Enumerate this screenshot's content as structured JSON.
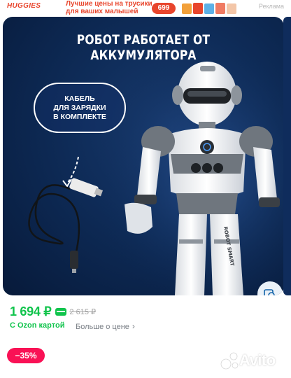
{
  "ad": {
    "brand": "HUGGIES",
    "line1": "Лучшие цены на трусики",
    "line2": "для ваших малышей",
    "price": "699",
    "mark": "Реклама"
  },
  "product_image": {
    "headline": "РОБОТ РАБОТАЕТ ОТ АККУМУЛЯТОРА",
    "badge_line1": "КАБЕЛЬ",
    "badge_line2": "ДЛЯ ЗАРЯДКИ",
    "badge_line3": "В КОМПЛЕКТЕ",
    "robot_side_text": "ROBOT SMART",
    "similar_icon": "image-search-icon"
  },
  "pricing": {
    "current": "1 694 ₽",
    "old": "2 615 ₽",
    "ozon_card_label": "С Ozon картой",
    "more_label": "Больше о цене",
    "more_icon": "chevron-right-icon",
    "discount": "−35%"
  },
  "watermark": {
    "text": "Avito"
  },
  "colors": {
    "accent_green": "#10c44c",
    "discount_pink": "#f91155",
    "ad_red": "#e8452c",
    "image_bg": "#0e2b57"
  }
}
